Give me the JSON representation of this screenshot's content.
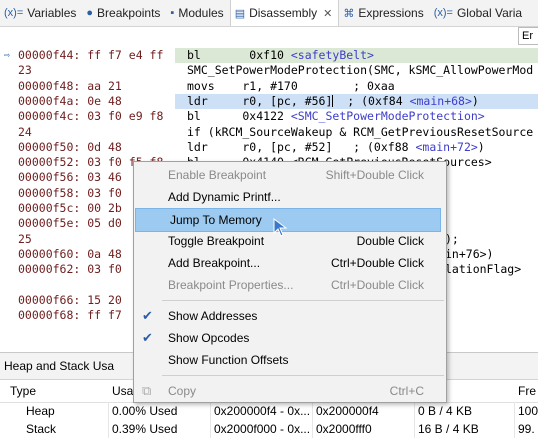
{
  "tabs": [
    {
      "label": "Variables",
      "icon": "variables-icon"
    },
    {
      "label": "Breakpoints",
      "icon": "breakpoints-icon"
    },
    {
      "label": "Modules",
      "icon": "modules-icon"
    },
    {
      "label": "Disassembly",
      "icon": "disassembly-icon",
      "active": true,
      "close": "✕"
    },
    {
      "label": "Expressions",
      "icon": "expressions-icon"
    },
    {
      "label": "Global Varia",
      "icon": "global-variables-icon"
    }
  ],
  "toolbar": {
    "btn_label": "Er"
  },
  "code": [
    {
      "addr": "00000f44: ff f7 e4 ff",
      "src_html": "bl       0xf10 <span class='lbl'>&lt;safetyBelt&gt;</span>",
      "hl": "green",
      "pc": true
    },
    {
      "addr": "23",
      "src": "SMC_SetPowerModeProtection(SMC, kSMC_AllowPowerMod"
    },
    {
      "addr": "00000f48: aa 21",
      "src": "movs    r1, #170        ; 0xaa"
    },
    {
      "addr": "00000f4a: 0e 48",
      "src_html": "ldr     r0, [pc, #56]<span class='cursor'></span>  ; (0xf84 <span class='lbl'>&lt;main+68&gt;</span>)",
      "hl": "blue"
    },
    {
      "addr": "00000f4c: 03 f0 e9 f8",
      "src_html": "bl      0x4122 <span class='lbl'>&lt;SMC_SetPowerModeProtection&gt;</span>"
    },
    {
      "addr": "24",
      "src": "if (kRCM_SourceWakeup & RCM_GetPreviousResetSource"
    },
    {
      "addr": "00000f50: 0d 48",
      "src_html": "ldr     r0, [pc, #52]   ; (0xf88 <span class='lbl'>&lt;main+72&gt;</span>)"
    },
    {
      "addr": "00000f52: 03 f0 f5 f8",
      "src": "bl      0x4140 <RCM_GetPreviousResetSources>"
    },
    {
      "addr": "00000f56: 03 46",
      "src": ""
    },
    {
      "addr": "00000f58: 03 f0",
      "src": ""
    },
    {
      "addr": "00000f5c: 00 2b",
      "src": ""
    },
    {
      "addr": "00000f5e: 05 d0",
      "src": ""
    },
    {
      "addr": "25",
      "src": ""
    },
    {
      "addr": "00000f60: 0a 48",
      "src": ""
    },
    {
      "addr": "00000f62: 03 f0",
      "src": ""
    },
    {
      "addr": "",
      "src": ""
    },
    {
      "addr": "00000f66: 15 20",
      "src": ""
    },
    {
      "addr": "00000f68: ff f7",
      "src": ""
    }
  ],
  "code_right_fragments": [
    {
      "text": ");",
      "row": 12
    },
    {
      "text": "in+76>)",
      "row": 13
    },
    {
      "text": "lationFlag>",
      "row": 14
    }
  ],
  "context_menu": {
    "items": [
      {
        "label": "Enable Breakpoint",
        "shortcut": "Shift+Double Click",
        "disabled": true
      },
      {
        "label": "Add Dynamic Printf...",
        "shortcut": ""
      },
      {
        "label": "Jump To Memory",
        "shortcut": "",
        "hover": true
      },
      {
        "label": "Toggle Breakpoint",
        "shortcut": "Double Click"
      },
      {
        "label": "Add Breakpoint...",
        "shortcut": "Ctrl+Double Click"
      },
      {
        "label": "Breakpoint Properties...",
        "shortcut": "Ctrl+Double Click",
        "disabled": true
      },
      {
        "sep": true
      },
      {
        "label": "Show Addresses",
        "shortcut": "",
        "checked": true
      },
      {
        "label": "Show Opcodes",
        "shortcut": "",
        "checked": true
      },
      {
        "label": "Show Function Offsets",
        "shortcut": ""
      },
      {
        "sep": true
      },
      {
        "label": "Copy",
        "shortcut": "Ctrl+C",
        "disabled": true,
        "icon": "copy-icon"
      }
    ]
  },
  "bottom_panel": {
    "title": "Heap and Stack Usa",
    "columns": [
      "Type",
      "Usa",
      "",
      "",
      "Fre"
    ],
    "rows": [
      {
        "type": "Heap",
        "usage": "0.00% Used",
        "start": "0x200000f4 - 0x...",
        "end": "0x200000f4",
        "size": "0 B / 4 KB",
        "free": "100"
      },
      {
        "type": "Stack",
        "usage": "0.39% Used",
        "start": "0x2000f000 - 0x...",
        "end": "0x2000fff0",
        "size": "16 B / 4 KB",
        "free": "99."
      }
    ]
  },
  "colors": {
    "accent": "#2a5fa8",
    "hover": "#9ccaf0",
    "label": "#3d3dcc",
    "address": "#6e1d1d"
  }
}
